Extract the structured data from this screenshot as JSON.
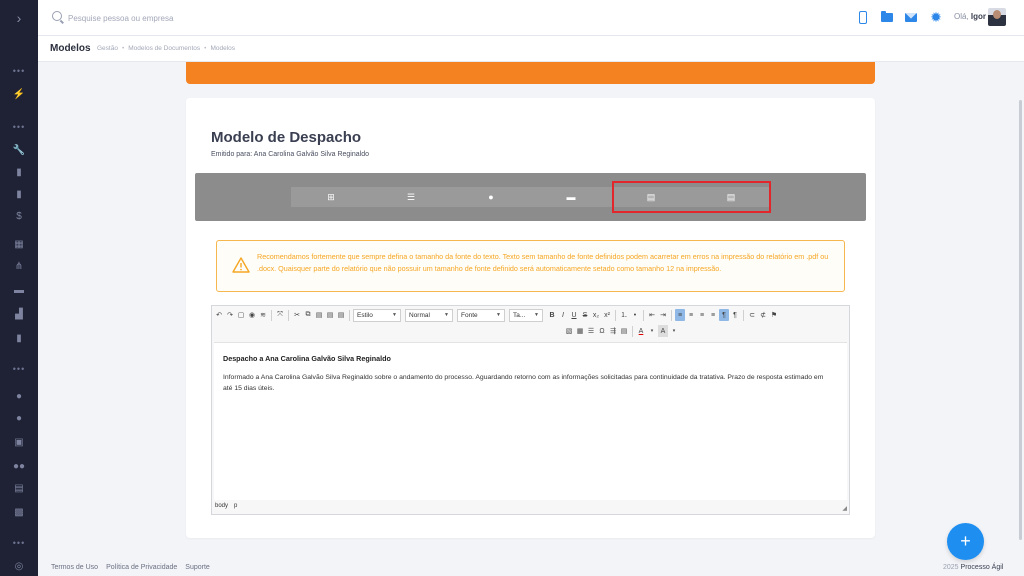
{
  "sidebar": {
    "toggle_icon": "›",
    "icons": [
      "bolt-icon",
      "wrench-icon",
      "document-icon",
      "document-icon",
      "dollar-icon",
      "calendar-icon",
      "network-icon",
      "folder-icon",
      "chart-icon",
      "copy-icon",
      "user-plus-icon",
      "briefcase-icon",
      "users-icon",
      "list-icon",
      "gift-icon",
      "globe-icon"
    ]
  },
  "topbar": {
    "search_placeholder": "Pesquise pessoa ou empresa",
    "greeting_prefix": "Olá,",
    "user_name": "Igor"
  },
  "header": {
    "title": "Modelos",
    "breadcrumb": [
      "Gestão",
      "Modelos de Documentos",
      "Modelos"
    ]
  },
  "card": {
    "title": "Modelo de Despacho",
    "subtitle": "Emitido para: Ana Carolina Galvão Silva Reginaldo",
    "tabs": [
      {
        "icon": "⊞",
        "name": "add-section-tab"
      },
      {
        "icon": "☰",
        "name": "settings-tab"
      },
      {
        "icon": "●",
        "name": "person-tab"
      },
      {
        "icon": "▬",
        "name": "archive-tab"
      },
      {
        "icon": "▤",
        "name": "document-tab"
      },
      {
        "icon": "▤",
        "name": "document-2-tab"
      }
    ],
    "warning": "Recomendamos fortemente que sempre defina o tamanho da fonte do texto. Texto sem tamanho de fonte definidos podem acarretar em erros na impressão do relatório em .pdf ou .docx. Quaisquer parte do relatório que não possuir um tamanho de fonte definido será automaticamente setado como tamanho 12 na impressão."
  },
  "editor": {
    "combo_style": "Estilo",
    "combo_format": "Normal",
    "combo_font": "Fonte",
    "combo_size": "Ta...",
    "heading": "Despacho a Ana Carolina Galvão Silva Reginaldo",
    "paragraph": "Informado a Ana Carolina Galvão Silva Reginaldo sobre o andamento do processo. Aguardando retorno com as informações solicitadas para continuidade da tratativa. Prazo de resposta estimado em até 15 dias úteis.",
    "status_path": [
      "body",
      "p"
    ]
  },
  "footer": {
    "links": [
      "Termos de Uso",
      "Política de Privacidade",
      "Suporte"
    ],
    "year": "2025",
    "brand": "Processo Ágil"
  },
  "colors": {
    "accent": "#1e8ff0",
    "orange": "#f58220",
    "warning": "#f5a623",
    "highlight": "#e3262b",
    "sidebar": "#1f2235"
  }
}
